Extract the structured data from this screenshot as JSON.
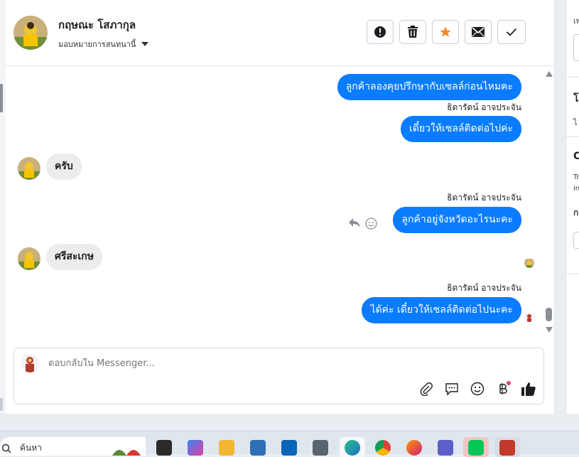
{
  "header": {
    "name": "กฤษณะ โสภากุล",
    "assign_label": "มอบหมายการสนทนานี้"
  },
  "actions": [
    "alert-icon",
    "trash-icon",
    "star-icon",
    "envelope-icon",
    "check-icon"
  ],
  "colors": {
    "outgoing_bubble": "#0a7cff",
    "star": "#f28a22",
    "incoming_bubble": "#ececec"
  },
  "messages": {
    "out1": "ลูกค้าลองคุยปรึกษากับเซลล์ก่อนไหมคะ",
    "out1_sender": "ธิดารัตน์ อาจประจัน",
    "out2": "เดี๋ยวให้เซลล์ติดต่อไปค่ะ",
    "in1": "ครับ",
    "out3_sender": "ธิดารัตน์ อาจประจัน",
    "out3": "ลูกค้าอยู่จังหวัดอะไรนะคะ",
    "in2": "ศรีสะเกษ",
    "out4_sender": "ธิดารัตน์ อาจประจัน",
    "out4": "ได้ค่ะ เดี๋ยวให้เซลล์ติดต่อไปนะคะ"
  },
  "composer": {
    "placeholder": "ตอบกลับใน Messenger..."
  },
  "right_panel": {
    "t1": "เพ",
    "t2": "โ",
    "t3": "ไ",
    "t4": "C",
    "t5": "Tr",
    "t6": "in",
    "t7": "ก"
  },
  "taskbar": {
    "search": "ค้นหา"
  }
}
